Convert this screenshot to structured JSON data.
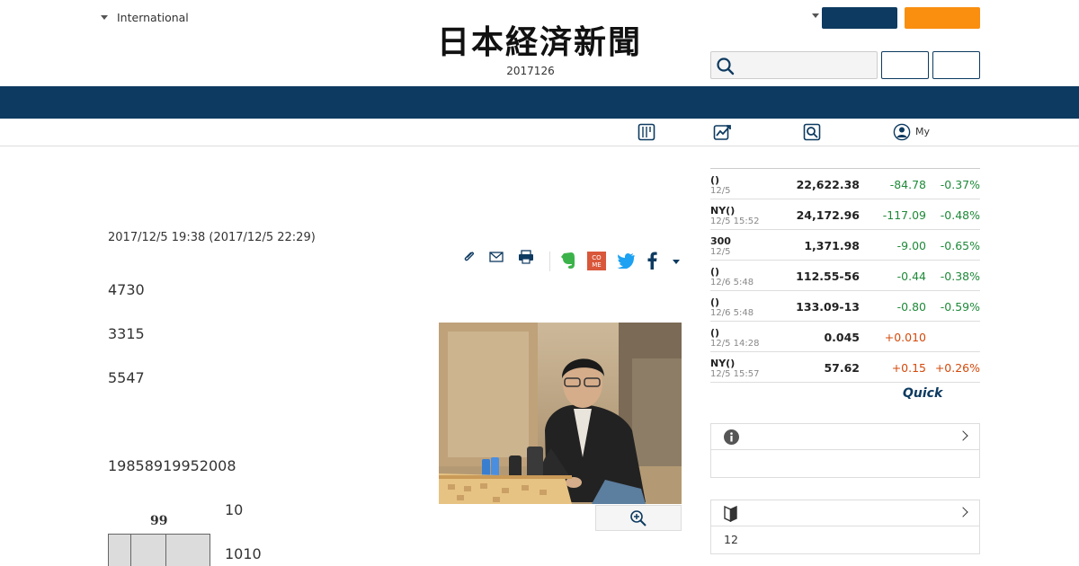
{
  "header": {
    "edition_label": "International",
    "masthead": "日本経済新聞",
    "masthead_date": "2017126"
  },
  "nav": {
    "my_label": "My"
  },
  "article": {
    "datetime": "2017/12/5 19:38 (2017/12/5 22:29)",
    "paragraphs": [
      "4730",
      "3315",
      "5547",
      "19858919952008",
      "10",
      "1010"
    ],
    "diagram_label": "99"
  },
  "markets": {
    "rows": [
      {
        "name": "()",
        "time": "12/5",
        "value": "22,622.38",
        "change": "-84.78",
        "pct": "-0.37%"
      },
      {
        "name": "NY()",
        "time": "12/5 15:52",
        "value": "24,172.96",
        "change": "-117.09",
        "pct": "-0.48%"
      },
      {
        "name": "300",
        "time": "12/5",
        "value": "1,371.98",
        "change": "-9.00",
        "pct": "-0.65%"
      },
      {
        "name": "()",
        "time": "12/6 5:48",
        "value": "112.55-56",
        "change": "-0.44",
        "pct": "-0.38%"
      },
      {
        "name": "()",
        "time": "12/6 5:48",
        "value": "133.09-13",
        "change": "-0.80",
        "pct": "-0.59%"
      },
      {
        "name": "()",
        "time": "12/5 14:28",
        "value": "0.045",
        "change": "+0.010",
        "pct": ""
      },
      {
        "name": "NY()",
        "time": "12/5 15:57",
        "value": "57.62",
        "change": "+0.15",
        "pct": "+0.26%"
      }
    ],
    "provider": "Quick",
    "colors": {
      "negative": "#1f8a39",
      "positive": "#d4490b"
    }
  },
  "widgets": {
    "info_body": "",
    "beginner_body": "12"
  },
  "colors": {
    "navy": "#0d3a60",
    "orange": "#f98e0f"
  }
}
